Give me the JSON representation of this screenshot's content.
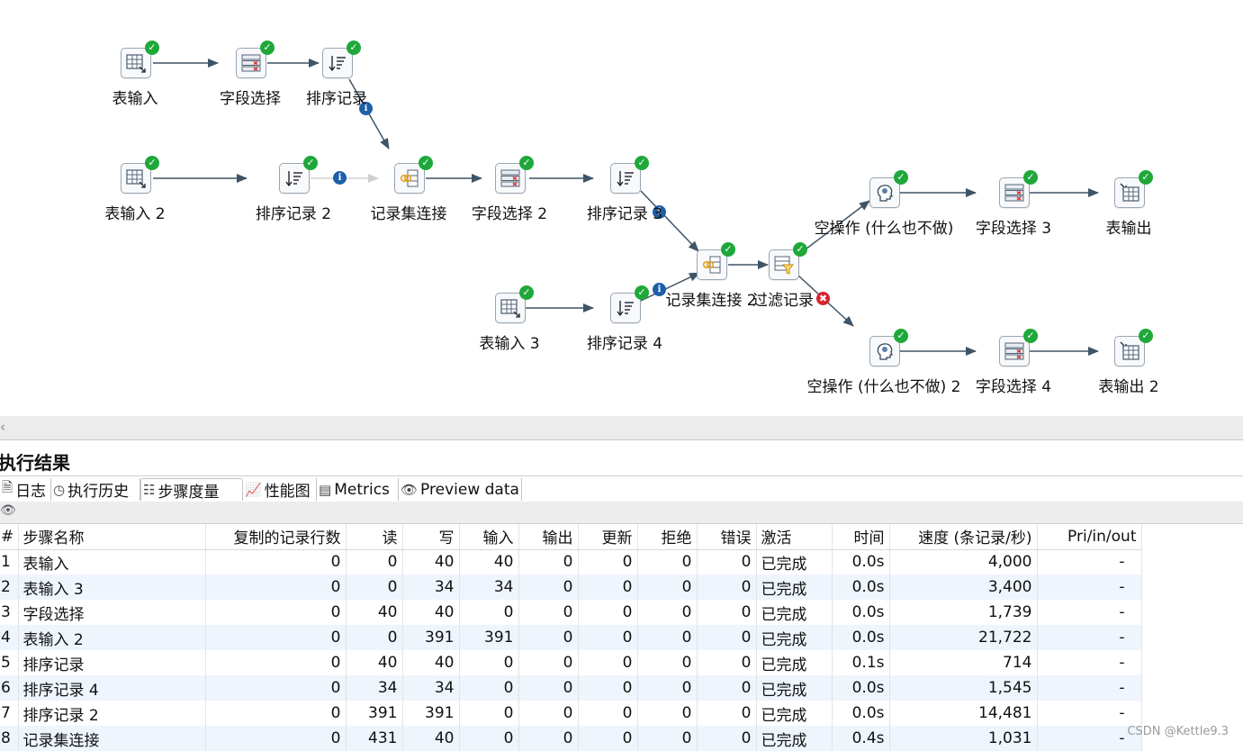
{
  "canvas": {
    "steps": [
      {
        "id": "s1",
        "label": "表输入",
        "icon": "table-input-icon"
      },
      {
        "id": "s2",
        "label": "字段选择",
        "icon": "select-values-icon"
      },
      {
        "id": "s3",
        "label": "排序记录",
        "icon": "sort-rows-icon"
      },
      {
        "id": "s4",
        "label": "表输入 2",
        "icon": "table-input-icon"
      },
      {
        "id": "s5",
        "label": "排序记录 2",
        "icon": "sort-rows-icon"
      },
      {
        "id": "s6",
        "label": "记录集连接",
        "icon": "merge-join-icon"
      },
      {
        "id": "s7",
        "label": "字段选择 2",
        "icon": "select-values-icon"
      },
      {
        "id": "s8",
        "label": "排序记录 3",
        "icon": "sort-rows-icon"
      },
      {
        "id": "s9",
        "label": "表输入 3",
        "icon": "table-input-icon"
      },
      {
        "id": "s10",
        "label": "排序记录 4",
        "icon": "sort-rows-icon"
      },
      {
        "id": "s11",
        "label": "记录集连接 2",
        "icon": "merge-join-icon"
      },
      {
        "id": "s12",
        "label": "过滤记录",
        "icon": "filter-rows-icon"
      },
      {
        "id": "s13",
        "label": "空操作 (什么也不做)",
        "icon": "dummy-icon"
      },
      {
        "id": "s14",
        "label": "字段选择 3",
        "icon": "select-values-icon"
      },
      {
        "id": "s15",
        "label": "表输出",
        "icon": "table-output-icon"
      },
      {
        "id": "s16",
        "label": "空操作 (什么也不做) 2",
        "icon": "dummy-icon"
      },
      {
        "id": "s17",
        "label": "字段选择 4",
        "icon": "select-values-icon"
      },
      {
        "id": "s18",
        "label": "表输出 2",
        "icon": "table-output-icon"
      }
    ]
  },
  "panel": {
    "title": "执行结果",
    "tabs": [
      {
        "label": "日志",
        "icon": "log-icon"
      },
      {
        "label": "执行历史",
        "icon": "history-icon"
      },
      {
        "label": "步骤度量",
        "icon": "step-metrics-icon"
      },
      {
        "label": "性能图",
        "icon": "performance-chart-icon"
      },
      {
        "label": "Metrics",
        "icon": "metrics-icon"
      },
      {
        "label": "Preview data",
        "icon": "eye-icon"
      }
    ],
    "active_tab": "步骤度量"
  },
  "table": {
    "headers": [
      "#",
      "步骤名称",
      "复制的记录行数",
      "读",
      "写",
      "输入",
      "输出",
      "更新",
      "拒绝",
      "错误",
      "激活",
      "时间",
      "速度 (条记录/秒)",
      "Pri/in/out"
    ],
    "rows": [
      [
        "1",
        "表输入",
        "0",
        "0",
        "40",
        "40",
        "0",
        "0",
        "0",
        "0",
        "已完成",
        "0.0s",
        "4,000",
        "-"
      ],
      [
        "2",
        "表输入 3",
        "0",
        "0",
        "34",
        "34",
        "0",
        "0",
        "0",
        "0",
        "已完成",
        "0.0s",
        "3,400",
        "-"
      ],
      [
        "3",
        "字段选择",
        "0",
        "40",
        "40",
        "0",
        "0",
        "0",
        "0",
        "0",
        "已完成",
        "0.0s",
        "1,739",
        "-"
      ],
      [
        "4",
        "表输入 2",
        "0",
        "0",
        "391",
        "391",
        "0",
        "0",
        "0",
        "0",
        "已完成",
        "0.0s",
        "21,722",
        "-"
      ],
      [
        "5",
        "排序记录",
        "0",
        "40",
        "40",
        "0",
        "0",
        "0",
        "0",
        "0",
        "已完成",
        "0.1s",
        "714",
        "-"
      ],
      [
        "6",
        "排序记录 4",
        "0",
        "34",
        "34",
        "0",
        "0",
        "0",
        "0",
        "0",
        "已完成",
        "0.0s",
        "1,545",
        "-"
      ],
      [
        "7",
        "排序记录 2",
        "0",
        "391",
        "391",
        "0",
        "0",
        "0",
        "0",
        "0",
        "已完成",
        "0.0s",
        "14,481",
        "-"
      ],
      [
        "8",
        "记录集连接",
        "0",
        "431",
        "40",
        "0",
        "0",
        "0",
        "0",
        "0",
        "已完成",
        "0.4s",
        "1,031",
        "-"
      ]
    ]
  },
  "watermark": "CSDN @Kettle9.3",
  "colors": {
    "ok": "#1fa83a",
    "info": "#1d5fa8",
    "error": "#d8232f",
    "hop": "#3e5467",
    "row_alt": "#eef5fd"
  }
}
